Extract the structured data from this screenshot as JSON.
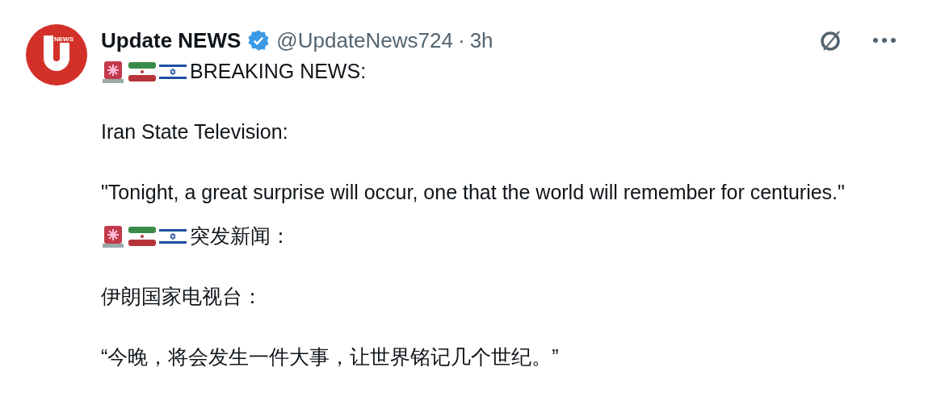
{
  "post": {
    "avatar_badge": "NEWS",
    "author": "Update NEWS",
    "verified": true,
    "handle": "@UpdateNews724",
    "separator": "·",
    "time": "3h",
    "blocks": [
      {
        "kind": "alert",
        "text": "BREAKING NEWS:"
      },
      {
        "kind": "text",
        "text": "Iran State Television:"
      },
      {
        "kind": "text",
        "text": "\"Tonight, a great surprise will occur, one that the world will remember for centuries.\""
      },
      {
        "kind": "alert",
        "text": "突发新闻："
      },
      {
        "kind": "text",
        "text": "伊朗国家电视台："
      },
      {
        "kind": "text",
        "text": "“今晚，将会发生一件大事，让世界铭记几个世纪。”"
      }
    ]
  }
}
